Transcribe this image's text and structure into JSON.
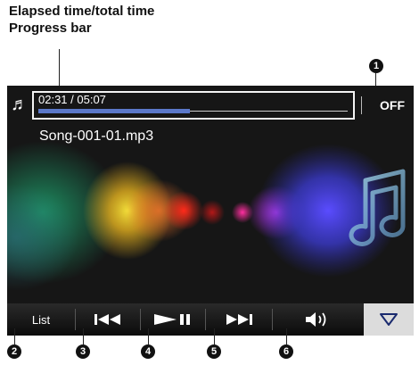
{
  "callout": {
    "line1": "Elapsed time/total time",
    "line2": "Progress bar"
  },
  "player": {
    "time": "02:31 / 05:07",
    "progress_fraction": 0.49,
    "repeat_state": "OFF",
    "song_title": "Song-001-01.mp3",
    "icons": [
      "music-note-icon",
      "previous-track-icon",
      "play-pause-icon",
      "next-track-icon",
      "volume-icon",
      "down-arrow-icon"
    ]
  },
  "controls": {
    "list_label": "List"
  },
  "badges": [
    "1",
    "2",
    "3",
    "4",
    "5",
    "6"
  ],
  "colors": {
    "progress_fill": "#5b78c9",
    "frame": "#f4f4f4",
    "background": "#141414"
  }
}
